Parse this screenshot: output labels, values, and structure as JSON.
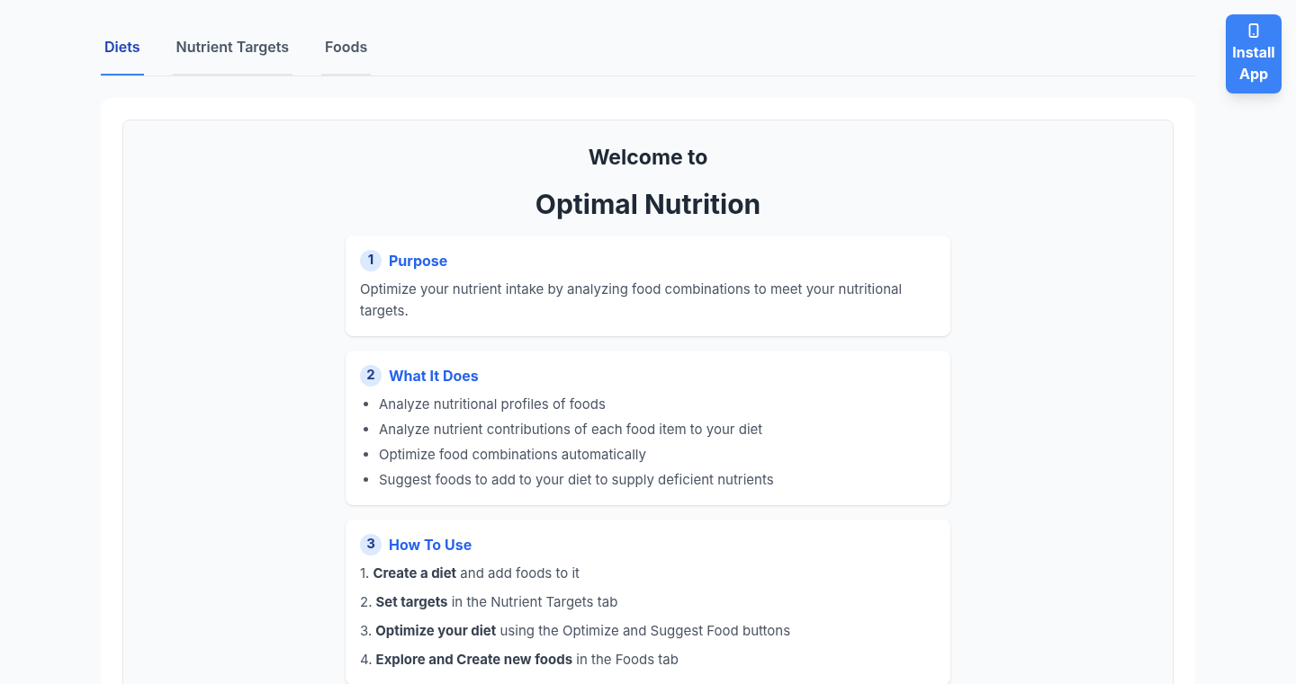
{
  "tabs": [
    {
      "label": "Diets",
      "selected": true
    },
    {
      "label": "Nutrient Targets",
      "selected": false
    },
    {
      "label": "Foods",
      "selected": false
    }
  ],
  "install_button": {
    "label": "Install App"
  },
  "welcome": {
    "subtitle": "Welcome to",
    "title": "Optimal Nutrition"
  },
  "sections": [
    {
      "kind": "paragraph",
      "number": "1",
      "title": "Purpose",
      "text": "Optimize your nutrient intake by analyzing food combinations to meet your nutritional targets."
    },
    {
      "kind": "bullets",
      "number": "2",
      "title": "What It Does",
      "items": [
        {
          "text": "Analyze nutritional profiles of foods"
        },
        {
          "text": "Analyze nutrient contributions of each food item to your diet"
        },
        {
          "text": "Optimize food combinations automatically"
        },
        {
          "text": "Suggest foods to add to your diet to supply deficient nutrients"
        }
      ]
    },
    {
      "kind": "numbered",
      "number": "3",
      "title": "How To Use",
      "items": [
        {
          "marker": "1.",
          "text": "**Create a diet** and add foods to it"
        },
        {
          "marker": "2.",
          "text": "**Set targets** in the Nutrient Targets tab"
        },
        {
          "marker": "3.",
          "text": "**Optimize your diet** using the Optimize and Suggest Food buttons"
        },
        {
          "marker": "4.",
          "text": "**Explore and Create new foods** in the Foods tab"
        }
      ]
    }
  ]
}
